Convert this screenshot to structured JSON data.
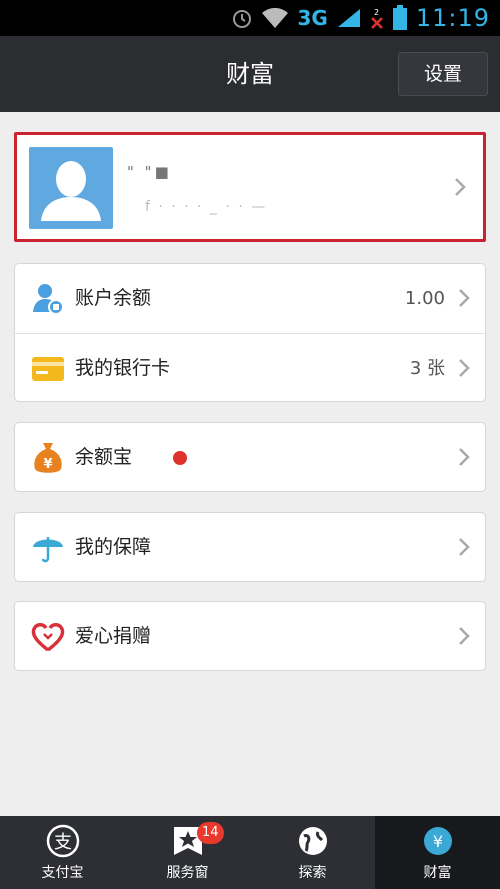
{
  "status_bar": {
    "network": "3G",
    "time": "11:19"
  },
  "header": {
    "title": "财富",
    "settings_label": "设置"
  },
  "profile": {
    "name": "\" \"■",
    "account": "f ·  ·   ·   ·  _  ·   ·  —"
  },
  "menu": {
    "balance_label": "账户余额",
    "balance_value": "1.00",
    "bank_label": "我的银行卡",
    "bank_value": "3 张",
    "yuebao_label": "余额宝",
    "insurance_label": "我的保障",
    "donate_label": "爱心捐赠"
  },
  "bottom_tabs": [
    {
      "label": "支付宝"
    },
    {
      "label": "服务窗",
      "badge": "14"
    },
    {
      "label": "探索"
    },
    {
      "label": "财富"
    }
  ],
  "colors": {
    "accent_blue": "#33b5e5",
    "highlight_red": "#c9232f",
    "header_bg": "#2b2d31"
  }
}
